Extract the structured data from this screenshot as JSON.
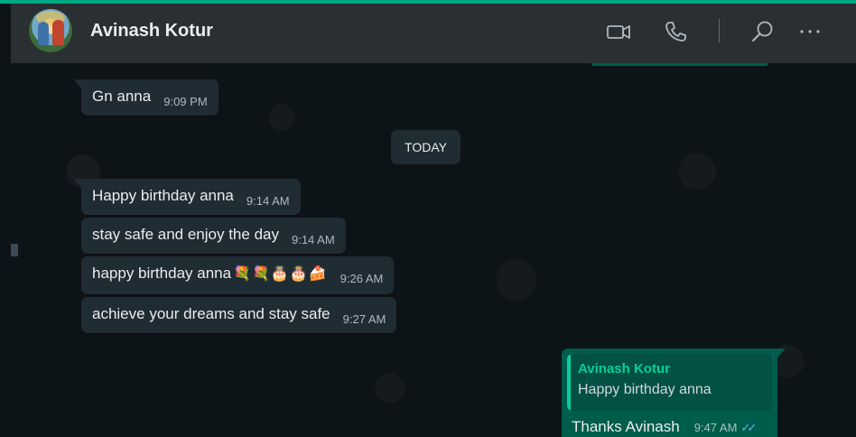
{
  "header": {
    "contact_name": "Avinash Kotur",
    "icons": [
      "video-call-icon",
      "voice-call-icon",
      "search-icon",
      "menu-icon"
    ]
  },
  "chat": {
    "day_divider": "TODAY",
    "incoming": [
      {
        "text": "Gn anna",
        "time": "9:09 PM"
      },
      {
        "text": "Happy birthday anna",
        "time": "9:14 AM"
      },
      {
        "text": "stay safe and enjoy the day",
        "time": "9:14 AM"
      },
      {
        "text": "happy birthday anna",
        "emoji": "💐💐🎂🎂🍰",
        "time": "9:26 AM"
      },
      {
        "text": "achieve your dreams and stay safe",
        "time": "9:27 AM"
      }
    ],
    "outgoing": {
      "quoted_author": "Avinash Kotur",
      "quoted_text": "Happy birthday anna",
      "text": "Thanks Avinash",
      "time": "9:47 AM",
      "status": "✓✓"
    }
  },
  "colors": {
    "accent": "#00a884",
    "incoming_bubble": "#202c33",
    "outgoing_bubble": "#005c4b",
    "header": "#2a2f32"
  }
}
